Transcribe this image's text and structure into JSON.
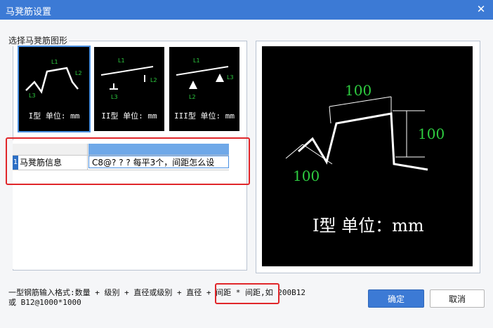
{
  "window": {
    "title": "马凳筋设置",
    "close_icon": "close-icon"
  },
  "shape_group": {
    "label": "选择马凳筋图形",
    "shapes": [
      {
        "name": "I型",
        "unit": "单位: mm",
        "label": "I型 单位: mm",
        "dims": [
          "L1",
          "L2",
          "L3"
        ],
        "selected": true
      },
      {
        "name": "II型",
        "unit": "单位: mm",
        "label": "II型 单位: mm",
        "dims": [
          "L1",
          "L2",
          "L3"
        ],
        "selected": false
      },
      {
        "name": "III型",
        "unit": "单位: mm",
        "label": "III型 单位: mm",
        "dims": [
          "L1",
          "L2",
          "L3"
        ],
        "selected": false
      }
    ]
  },
  "info_grid": {
    "rows": [
      {
        "index": "1",
        "name": "马凳筋信息",
        "value": "C8@? ? ? 每平3个，间距怎么设"
      }
    ]
  },
  "preview": {
    "label": "I型  单位：mm",
    "dim_top": "100",
    "dim_right": "100",
    "dim_left": "100",
    "line_color": "#ffffff",
    "dim_color": "#2ecc40"
  },
  "hint": {
    "line1": "一型钢筋输入格式:数量 + 级别 + 直径或级别 + 直径 + 间距 * 间距,如 200B12",
    "line2": "或 B12@1000*1000"
  },
  "buttons": {
    "ok": "确定",
    "cancel": "取消"
  },
  "colors": {
    "titlebar": "#3c7ad5",
    "highlight": "#e0262a",
    "accent": "#2d6fc4"
  }
}
